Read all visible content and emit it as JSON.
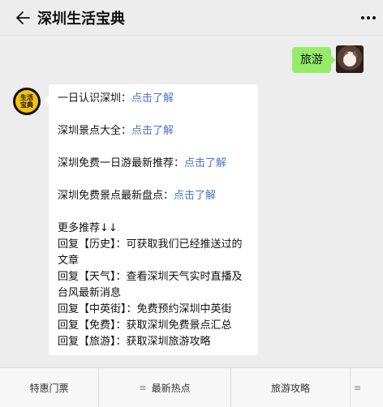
{
  "header": {
    "title": "深圳生活宝典",
    "back_icon": "back-arrow-icon",
    "more_icon": "more-dots-icon"
  },
  "outgoing": {
    "text": "旅游"
  },
  "bot_avatar": {
    "line1": "生活",
    "line2": "宝典",
    "bg": "#f3c10f"
  },
  "incoming": {
    "items": [
      {
        "label": "一日认识深圳：",
        "link": "点击了解"
      },
      {
        "label": "深圳景点大全：",
        "link": "点击了解"
      },
      {
        "label": "深圳免费一日游最新推荐：",
        "link": "点击了解"
      },
      {
        "label": "深圳免费景点最新盘点：",
        "link": "点击了解"
      }
    ],
    "more_title": "更多推荐↓↓",
    "replies": [
      "回复【历史】：可获取我们已经推送过的文章",
      "回复【天气】：查看深圳天气实时直播及台风最新消息",
      "回复【中英街】：免费预约深圳中英街",
      "回复【免费】：获取深圳免费景点汇总",
      "回复【旅游】：获取深圳旅游攻略"
    ]
  },
  "menu": {
    "items": [
      {
        "label": "特惠门票",
        "icon": ""
      },
      {
        "label": "最新热点",
        "icon": "≡"
      },
      {
        "label": "旅游攻略",
        "icon": ""
      },
      {
        "label": "",
        "icon": "≡"
      }
    ]
  },
  "colors": {
    "outgoing_bubble": "#95ec69",
    "link": "#4a78c2",
    "background": "#ededed"
  }
}
